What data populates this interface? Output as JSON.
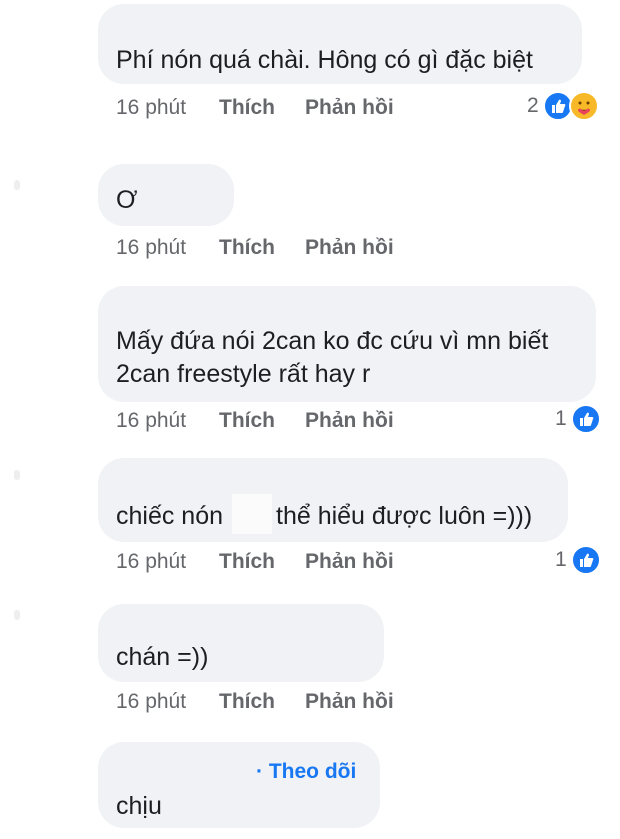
{
  "comments": [
    {
      "text": "Phí nón quá chài. Hông có gì đặc biệt",
      "time": "16 phút",
      "like_label": "Thích",
      "reply_label": "Phản hồi",
      "reaction_count": "2",
      "reactions": [
        "like-icon",
        "care-icon"
      ]
    },
    {
      "text": "Ơ",
      "time": "16 phút",
      "like_label": "Thích",
      "reply_label": "Phản hồi"
    },
    {
      "text_lines": [
        "Mấy đứa nói 2can ko đc cứu vì mn biết",
        "2can freestyle rất hay r"
      ],
      "time": "16 phút",
      "like_label": "Thích",
      "reply_label": "Phản hồi",
      "reaction_count": "1",
      "reactions": [
        "like-icon"
      ]
    },
    {
      "text_parts": [
        "chiếc nón",
        "thể hiểu được luôn =)))"
      ],
      "time": "16 phút",
      "like_label": "Thích",
      "reply_label": "Phản hồi",
      "reaction_count": "1",
      "reactions": [
        "like-icon"
      ]
    },
    {
      "text": "chán =))",
      "time": "16 phút",
      "like_label": "Thích",
      "reply_label": "Phản hồi"
    },
    {
      "follow_label": "· Theo dõi",
      "text": "chịu"
    }
  ],
  "colors": {
    "bubble": "#f0f2f5",
    "meta_text": "#65676b",
    "like_blue": "#1877f2",
    "care_yellow": "#f7b928"
  }
}
